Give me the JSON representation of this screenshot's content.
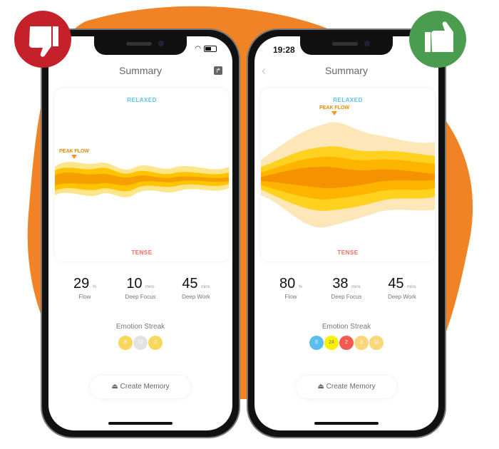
{
  "colors": {
    "blob": "#ef8325",
    "bad": "#c4212a",
    "good": "#4a9d4e",
    "relaxed": "#5bc0eb",
    "tense": "#f26b5b"
  },
  "badges": {
    "left": "thumbs-down-icon",
    "right": "thumbs-up-icon"
  },
  "left": {
    "time": "",
    "title": "Summary",
    "relaxed": "RELAXED",
    "tense": "TENSE",
    "peak": "PEAK FLOW",
    "stats": [
      {
        "value": "29",
        "unit": "%",
        "label": "Flow"
      },
      {
        "value": "10",
        "unit": "mins",
        "label": "Deep Focus"
      },
      {
        "value": "45",
        "unit": "mins",
        "label": "Deep Work"
      }
    ],
    "streak_title": "Emotion Streak",
    "streak": [
      {
        "n": "8",
        "color": "#f7d85c"
      },
      {
        "n": "12",
        "color": "#e3e3e3"
      },
      {
        "n": "2",
        "color": "#f7d85c"
      }
    ],
    "create": "Create Memory"
  },
  "right": {
    "time": "19:28",
    "title": "Summary",
    "relaxed": "RELAXED",
    "tense": "TENSE",
    "peak": "PEAK FLOW",
    "stats": [
      {
        "value": "80",
        "unit": "%",
        "label": "Flow"
      },
      {
        "value": "38",
        "unit": "mins",
        "label": "Deep Focus"
      },
      {
        "value": "45",
        "unit": "mins",
        "label": "Deep Work"
      }
    ],
    "streak_title": "Emotion Streak",
    "streak": [
      {
        "n": "5",
        "color": "#5bbcf0"
      },
      {
        "n": "24",
        "color": "#f7f000"
      },
      {
        "n": "2",
        "color": "#f05a50"
      },
      {
        "n": "3",
        "color": "#f9d77a"
      },
      {
        "n": "11",
        "color": "#f9d77a"
      }
    ],
    "create": "Create Memory"
  }
}
